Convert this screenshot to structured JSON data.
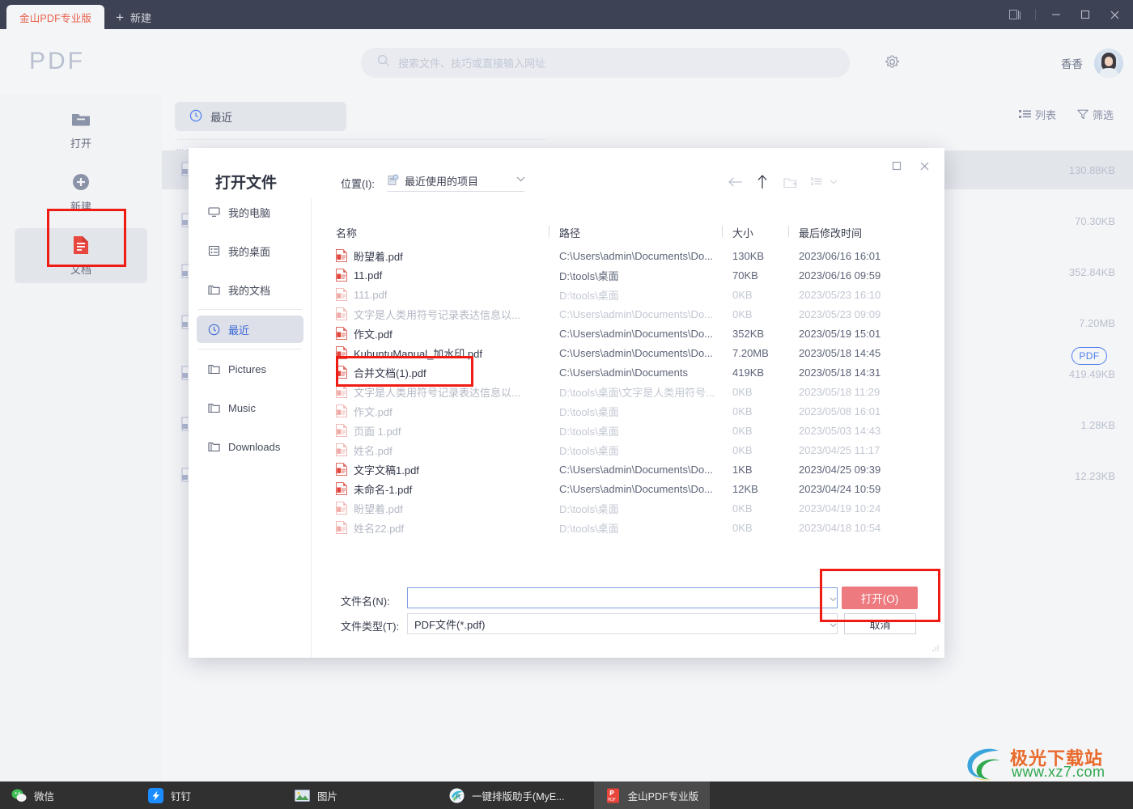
{
  "window": {
    "tab_label": "金山PDF专业版",
    "new_tab_label": "新建",
    "controls": {
      "restore_windows": "⧉",
      "minimize": "—",
      "maximize": "□",
      "close": "✕"
    }
  },
  "header": {
    "logo": "PDF",
    "search_placeholder": "搜索文件、技巧或直接输入网址",
    "user_name": "香香"
  },
  "leftnav": {
    "items": [
      {
        "label": "打开",
        "icon": "folder-icon"
      },
      {
        "label": "新建",
        "icon": "plus-circle-icon"
      },
      {
        "label": "文档",
        "icon": "document-icon",
        "selected": true
      }
    ]
  },
  "content": {
    "recent_label": "最近",
    "section_label": "常用",
    "view_list_label": "列表",
    "view_filter_label": "筛选",
    "rows": [
      {
        "size": "130.88KB",
        "highlighted": true
      },
      {
        "size": "70.30KB"
      },
      {
        "size": "352.84KB"
      },
      {
        "size": "7.20MB"
      },
      {
        "size": "419.49KB"
      },
      {
        "size": "1.28KB"
      },
      {
        "size": "12.23KB"
      }
    ]
  },
  "dialog": {
    "title": "打开文件",
    "location_label": "位置(I):",
    "location_value": "最近使用的项目",
    "pdf_badge": "PDF",
    "toolbar": {
      "back": "back-arrow-icon",
      "up": "up-arrow-icon",
      "new_folder": "new-folder-icon",
      "view_mode": "view-mode-icon"
    },
    "sidebar": [
      {
        "label": "我的电脑",
        "icon": "computer-icon"
      },
      {
        "label": "我的桌面",
        "icon": "desktop-icon"
      },
      {
        "label": "我的文档",
        "icon": "folder-icon"
      },
      {
        "label": "最近",
        "icon": "clock-icon",
        "selected": true
      },
      {
        "label": "Pictures",
        "icon": "folder-icon"
      },
      {
        "label": "Music",
        "icon": "folder-icon"
      },
      {
        "label": "Downloads",
        "icon": "folder-icon"
      }
    ],
    "columns": [
      "名称",
      "路径",
      "大小",
      "最后修改时间"
    ],
    "files": [
      {
        "name": "盼望着.pdf",
        "path": "C:\\Users\\admin\\Documents\\Do...",
        "size": "130KB",
        "time": "2023/06/16 16:01",
        "dim": false
      },
      {
        "name": "11.pdf",
        "path": "D:\\tools\\桌面",
        "size": "70KB",
        "time": "2023/06/16 09:59",
        "dim": false
      },
      {
        "name": "111.pdf",
        "path": "D:\\tools\\桌面",
        "size": "0KB",
        "time": "2023/05/23 16:10",
        "dim": true
      },
      {
        "name": "文字是人类用符号记录表达信息以...",
        "path": "C:\\Users\\admin\\Documents\\Do...",
        "size": "0KB",
        "time": "2023/05/23 09:09",
        "dim": true
      },
      {
        "name": "作文.pdf",
        "path": "C:\\Users\\admin\\Documents\\Do...",
        "size": "352KB",
        "time": "2023/05/19 15:01",
        "dim": false
      },
      {
        "name": "KubuntuManual_加水印.pdf",
        "path": "C:\\Users\\admin\\Documents\\Do...",
        "size": "7.20MB",
        "time": "2023/05/18 14:45",
        "dim": false
      },
      {
        "name": "合并文档(1).pdf",
        "path": "C:\\Users\\admin\\Documents",
        "size": "419KB",
        "time": "2023/05/18 14:31",
        "dim": false
      },
      {
        "name": "文字是人类用符号记录表达信息以...",
        "path": "D:\\tools\\桌面\\文字是人类用符号...",
        "size": "0KB",
        "time": "2023/05/18 11:29",
        "dim": true
      },
      {
        "name": "作文.pdf",
        "path": "D:\\tools\\桌面",
        "size": "0KB",
        "time": "2023/05/08 16:01",
        "dim": true
      },
      {
        "name": "页面 1.pdf",
        "path": "D:\\tools\\桌面",
        "size": "0KB",
        "time": "2023/05/03 14:43",
        "dim": true
      },
      {
        "name": "姓名.pdf",
        "path": "D:\\tools\\桌面",
        "size": "0KB",
        "time": "2023/04/25 11:17",
        "dim": true
      },
      {
        "name": "文字文稿1.pdf",
        "path": "C:\\Users\\admin\\Documents\\Do...",
        "size": "1KB",
        "time": "2023/04/25 09:39",
        "dim": false
      },
      {
        "name": "未命名-1.pdf",
        "path": "C:\\Users\\admin\\Documents\\Do...",
        "size": "12KB",
        "time": "2023/04/24 10:59",
        "dim": false
      },
      {
        "name": "盼望着.pdf",
        "path": "D:\\tools\\桌面",
        "size": "0KB",
        "time": "2023/04/19 10:24",
        "dim": true
      },
      {
        "name": "姓名22.pdf",
        "path": "D:\\tools\\桌面",
        "size": "0KB",
        "time": "2023/04/18 10:54",
        "dim": true
      }
    ],
    "filename_label": "文件名(N):",
    "filename_value": "",
    "filetype_label": "文件类型(T):",
    "filetype_value": "PDF文件(*.pdf)",
    "open_button": "打开(O)",
    "cancel_button": "取消"
  },
  "taskbar": {
    "items": [
      {
        "label": "微信",
        "icon": "wechat-icon",
        "active": false
      },
      {
        "label": "钉钉",
        "icon": "dingtalk-icon",
        "active": false
      },
      {
        "label": "图片",
        "icon": "photos-icon",
        "active": false
      },
      {
        "label": "一键排版助手(MyE...",
        "icon": "layout-helper-icon",
        "active": false
      },
      {
        "label": "金山PDF专业版",
        "icon": "kingsoft-pdf-icon",
        "active": true
      }
    ]
  },
  "watermark": {
    "line1": "极光下载站",
    "line2": "www.xz7.com"
  },
  "colors": {
    "titlebar": "#3d4354",
    "brand_red": "#e8604c",
    "accent_blue": "#3a67d8",
    "highlight_red": "#ef1c13",
    "open_button": "#ec7a7e"
  }
}
